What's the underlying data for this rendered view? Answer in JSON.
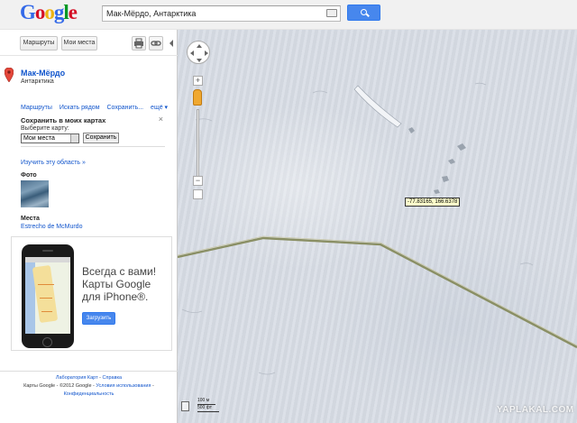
{
  "header": {
    "logo_letters": [
      {
        "ch": "G",
        "color": "#3369e8"
      },
      {
        "ch": "o",
        "color": "#d50f25"
      },
      {
        "ch": "o",
        "color": "#eeb211"
      },
      {
        "ch": "g",
        "color": "#3369e8"
      },
      {
        "ch": "l",
        "color": "#009925"
      },
      {
        "ch": "e",
        "color": "#d50f25"
      }
    ],
    "search_value": "Мак-Мёрдо, Антарктика",
    "search_icon": "search-icon",
    "keyboard_icon": "keyboard-icon"
  },
  "toolbar": {
    "routes_label": "Маршруты",
    "mymaps_label": "Мои места",
    "print_icon": "print-icon",
    "link_icon": "link-icon"
  },
  "place": {
    "title": "Мак-Мёрдо",
    "subtitle": "Антарктика",
    "actions": [
      "Маршруты",
      "Искать рядом",
      "Сохранить..."
    ],
    "more_label": "ещё ▾"
  },
  "save_panel": {
    "title": "Сохранить в моих картах",
    "choose_label": "Выберите карту:",
    "selected_map": "Мои места",
    "submit_label": "Сохранить",
    "close_label": "×"
  },
  "explore_label": "Изучить эту область »",
  "photos_heading": "Фото",
  "places_heading": "Места",
  "places_link": "Estrecho de McMurdo",
  "ad": {
    "text_line1": "Всегда с вами!",
    "text_line2": "Карты Google",
    "text_line3": "для iPhone®.",
    "button_label": "Загрузить"
  },
  "footer": {
    "labs_link": "Лаборатория Карт",
    "help_link": "Справка",
    "copyright": "Карты Google - ©2012 Google -",
    "terms_link": "Условия использования",
    "privacy_link": "Конфиденциальность"
  },
  "map": {
    "coords_label": "-77.83165, 166.6378",
    "scale_top": "100 м",
    "scale_bottom": "500 фт",
    "zoom_plus": "+",
    "zoom_minus": "−"
  },
  "watermark": "YAPLAKAL.COM",
  "colors": {
    "accent_blue": "#4787ed",
    "link_blue": "#1155cc",
    "snow": "#d9dee6",
    "tooltip_bg": "#ffffcc"
  }
}
